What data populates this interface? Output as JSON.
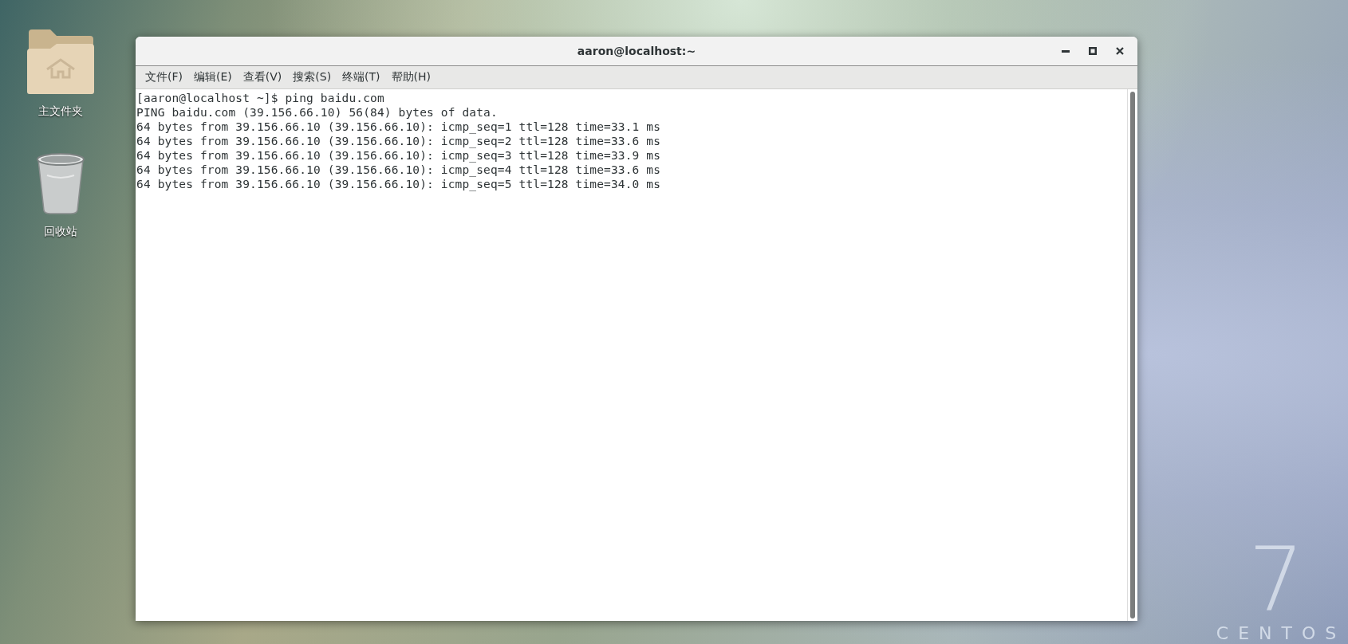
{
  "desktop": {
    "icons": [
      {
        "kind": "folder",
        "label": "主文件夹"
      },
      {
        "kind": "trash",
        "label": "回收站"
      }
    ],
    "wallpaper": {
      "version": "7",
      "brand": "CENTOS"
    }
  },
  "window": {
    "title": "aaron@localhost:~",
    "menu": [
      "文件(F)",
      "编辑(E)",
      "查看(V)",
      "搜索(S)",
      "终端(T)",
      "帮助(H)"
    ],
    "terminal": {
      "lines": [
        "[aaron@localhost ~]$ ping baidu.com",
        "PING baidu.com (39.156.66.10) 56(84) bytes of data.",
        "64 bytes from 39.156.66.10 (39.156.66.10): icmp_seq=1 ttl=128 time=33.1 ms",
        "64 bytes from 39.156.66.10 (39.156.66.10): icmp_seq=2 ttl=128 time=33.6 ms",
        "64 bytes from 39.156.66.10 (39.156.66.10): icmp_seq=3 ttl=128 time=33.9 ms",
        "64 bytes from 39.156.66.10 (39.156.66.10): icmp_seq=4 ttl=128 time=33.6 ms",
        "64 bytes from 39.156.66.10 (39.156.66.10): icmp_seq=5 ttl=128 time=34.0 ms"
      ]
    }
  }
}
